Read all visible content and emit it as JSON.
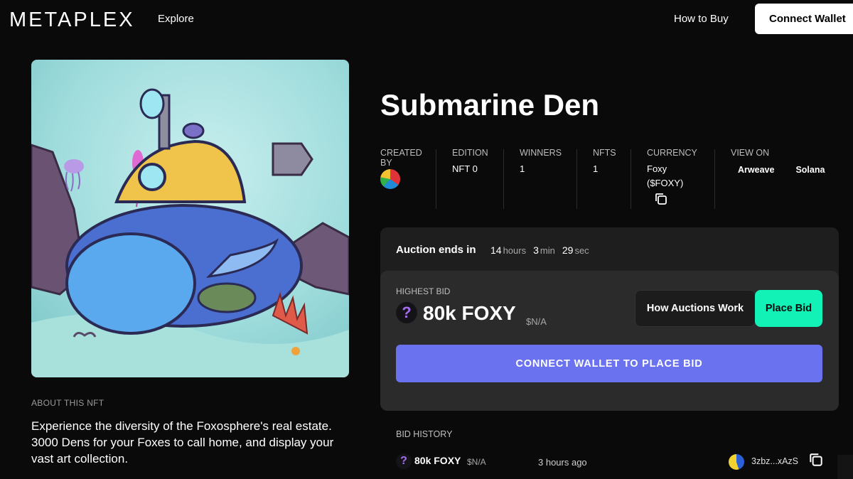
{
  "header": {
    "logo": "METAPLEX",
    "explore_label": "Explore",
    "how_to_buy_label": "How to Buy",
    "connect_wallet_label": "Connect Wallet"
  },
  "artwork": {
    "alt": "Submarine Den illustration"
  },
  "about": {
    "label": "ABOUT THIS NFT",
    "text": "Experience the diversity of the Foxosphere's real estate. 3000 Dens for your Foxes to call home, and display your vast art collection."
  },
  "nft": {
    "title": "Submarine Den",
    "created_by_label": "CREATED BY",
    "edition_label": "EDITION",
    "edition_value": "NFT 0",
    "winners_label": "WINNERS",
    "winners_value": "1",
    "nfts_label": "NFTS",
    "nfts_value": "1",
    "currency_label": "CURRENCY",
    "currency_value": "Foxy ($FOXY)",
    "view_on_label": "VIEW ON",
    "view_links": [
      "Arweave",
      "Solana"
    ]
  },
  "auction": {
    "ends_label": "Auction ends in",
    "hours": "14",
    "hours_unit": "hours",
    "minutes": "3",
    "minutes_unit": "min",
    "seconds": "29",
    "seconds_unit": "sec",
    "highest_bid_label": "HIGHEST BID",
    "token_icon": "?",
    "highest_bid_amount": "80k FOXY",
    "highest_bid_usd": "$N/A",
    "how_auctions_work_label": "How Auctions Work",
    "place_bid_label": "Place Bid",
    "connect_to_bid_label": "CONNECT WALLET TO PLACE BID"
  },
  "bid_history": {
    "label": "BID HISTORY",
    "rows": [
      {
        "token_icon": "?",
        "amount": "80k FOXY",
        "usd": "$N/A",
        "time": "3 hours ago",
        "address": "3zbz...xAzS"
      }
    ]
  },
  "colors": {
    "background": "#0a0a0a",
    "card": "#1e1e1e",
    "bid_card": "#2b2b2b",
    "place_bid": "#12f2b6",
    "connect_to_bid": "#6a72f0"
  }
}
